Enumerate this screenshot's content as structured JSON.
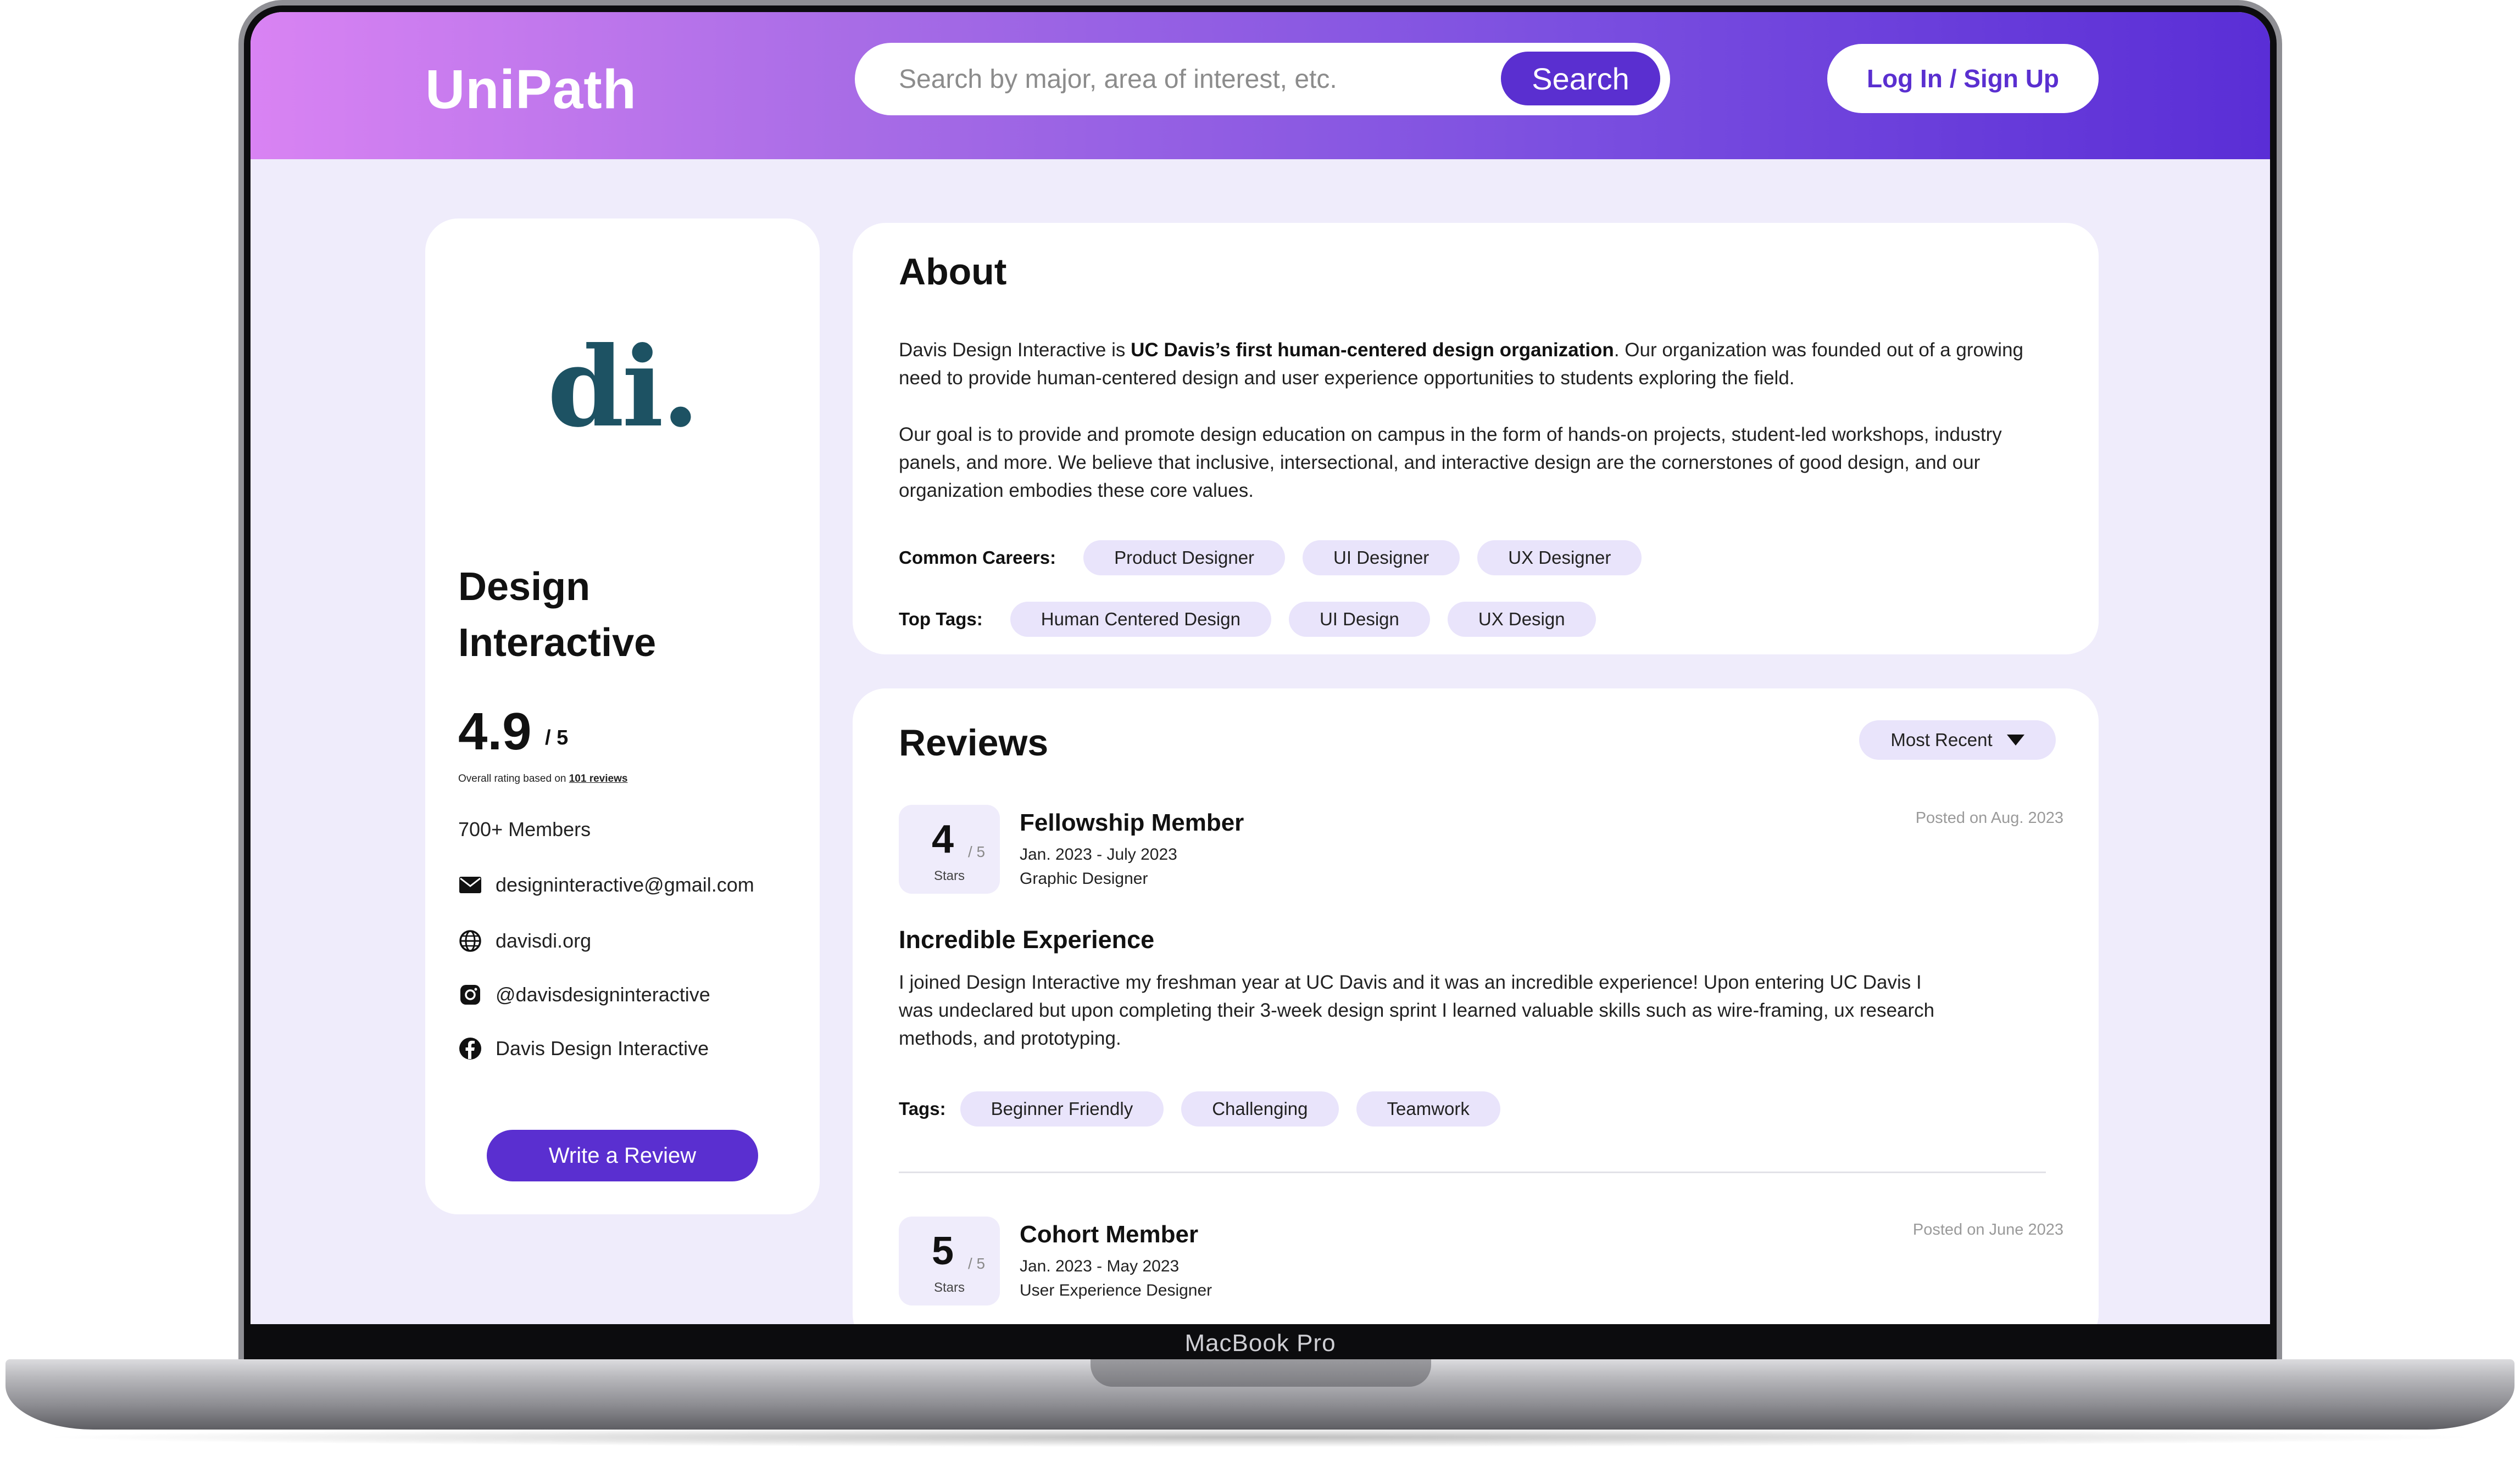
{
  "device": {
    "label": "MacBook Pro"
  },
  "header": {
    "logo": "UniPath",
    "search": {
      "placeholder": "Search by major, area of interest, etc.",
      "button": "Search"
    },
    "login_button": "Log In / Sign Up"
  },
  "profile": {
    "logo_text": "di.",
    "name": "Design Interactive",
    "rating": {
      "value": "4.9",
      "max": "/ 5",
      "note_prefix": "Overall rating based on",
      "note_link": "101 reviews"
    },
    "members": "700+ Members",
    "contacts": [
      {
        "icon": "mail-icon",
        "text": "designinteractive@gmail.com"
      },
      {
        "icon": "globe-icon",
        "text": "davisdi.org"
      },
      {
        "icon": "instagram-icon",
        "text": "@davisdesigninteractive"
      },
      {
        "icon": "facebook-icon",
        "text": "Davis Design Interactive"
      }
    ],
    "write_review_button": "Write a Review"
  },
  "about": {
    "title": "About",
    "p1_start": "Davis Design Interactive is ",
    "p1_bold": "UC Davis’s first human-centered design organization",
    "p1_end": ". Our organization was founded out of a growing need to provide human-centered design and user experience opportunities to students exploring the field.",
    "p2": "Our goal is to provide and promote design education on campus in the form of hands-on projects, student-led workshops, industry panels, and more. We believe that inclusive, intersectional, and interactive design are the cornerstones of good design, and our organization embodies these core values.",
    "careers_label": "Common Careers:",
    "careers": [
      "Product Designer",
      "UI Designer",
      "UX Designer"
    ],
    "tags_label": "Top Tags:",
    "tags": [
      "Human Centered Design",
      "UI Design",
      "UX Design"
    ]
  },
  "reviews": {
    "title": "Reviews",
    "sort": "Most Recent",
    "stars_label": "Stars",
    "items": [
      {
        "score": "4",
        "max": "/ 5",
        "reviewer": "Fellowship Member",
        "dates": "Jan. 2023 - July 2023",
        "role": "Graphic Designer",
        "posted": "Posted on Aug. 2023",
        "title": "Incredible Experience",
        "body": "I joined Design Interactive my freshman year at UC Davis and it was an incredible experience! Upon entering UC Davis I was undeclared but upon completing their 3-week design sprint I learned valuable skills such as wire-framing, ux research methods, and prototyping.",
        "tags_label": "Tags:",
        "tags": [
          "Beginner Friendly",
          "Challenging",
          "Teamwork"
        ]
      },
      {
        "score": "5",
        "max": "/ 5",
        "reviewer": "Cohort Member",
        "dates": "Jan. 2023 - May 2023",
        "role": "User Experience Designer",
        "posted": "Posted on June 2023"
      }
    ]
  }
}
